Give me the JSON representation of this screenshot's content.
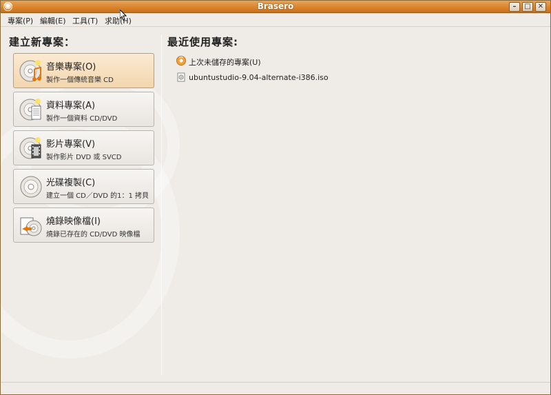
{
  "window": {
    "title": "Brasero"
  },
  "menu": [
    "專案(P)",
    "編輯(E)",
    "工具(T)",
    "求助(H)"
  ],
  "left": {
    "title": "建立新專案：",
    "projects": [
      {
        "label": "音樂專案(O)",
        "desc": "製作一個傳統音樂 CD",
        "icon": "audio-cd-icon",
        "active": true
      },
      {
        "label": "資料專案(A)",
        "desc": "製作一個資料 CD/DVD",
        "icon": "data-disc-icon",
        "active": false
      },
      {
        "label": "影片專案(V)",
        "desc": "製作影片 DVD 或 SVCD",
        "icon": "video-disc-icon",
        "active": false
      },
      {
        "label": "光碟複製(C)",
        "desc": "建立一個 CD／DVD 的1：1 拷貝",
        "icon": "disc-copy-icon",
        "active": false
      },
      {
        "label": "燒錄映像檔(I)",
        "desc": "燒錄已存在的 CD/DVD 映像檔",
        "icon": "burn-image-icon",
        "active": false
      }
    ]
  },
  "right": {
    "title": "最近使用專案:",
    "items": [
      {
        "text": "上次未儲存的專案(U)",
        "icon": "brasero-project-icon"
      },
      {
        "text": "ubuntustudio-9.04-alternate-i386.iso",
        "icon": "iso-file-icon"
      }
    ]
  }
}
